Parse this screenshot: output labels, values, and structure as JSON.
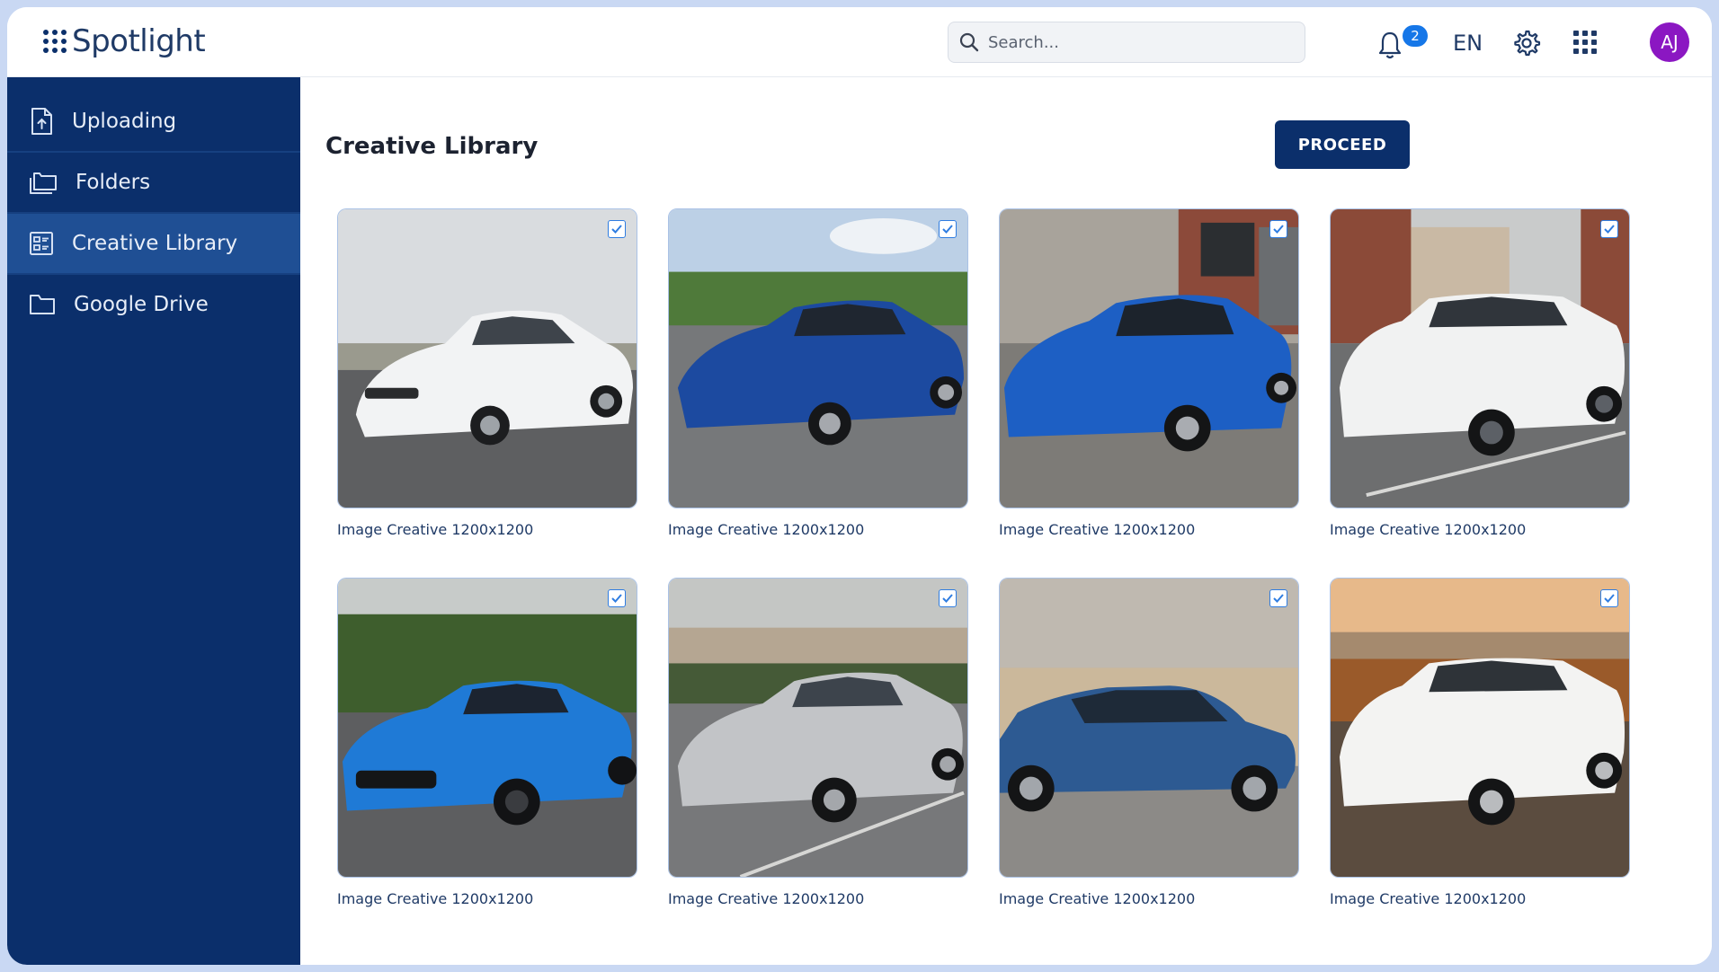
{
  "app": {
    "name": "Spotlight"
  },
  "header": {
    "search_placeholder": "Search...",
    "notifications_count": "2",
    "language": "EN",
    "user_initials": "AJ",
    "avatar_color": "#8b17c2"
  },
  "sidebar": {
    "items": [
      {
        "label": "Uploading",
        "icon": "upload-file-icon",
        "active": false
      },
      {
        "label": "Folders",
        "icon": "folders-icon",
        "active": false
      },
      {
        "label": "Creative Library",
        "icon": "library-icon",
        "active": true
      },
      {
        "label": "Google Drive",
        "icon": "folder-icon",
        "active": false
      }
    ]
  },
  "main": {
    "title": "Creative Library",
    "proceed_label": "PROCEED",
    "creatives": [
      {
        "caption": "Image Creative 1200x1200",
        "checked": true,
        "car": "white sedan"
      },
      {
        "caption": "Image Creative 1200x1200",
        "checked": true,
        "car": "blue sedan"
      },
      {
        "caption": "Image Creative 1200x1200",
        "checked": true,
        "car": "blue sedan"
      },
      {
        "caption": "Image Creative 1200x1200",
        "checked": true,
        "car": "white SUV"
      },
      {
        "caption": "Image Creative 1200x1200",
        "checked": true,
        "car": "blue coupe"
      },
      {
        "caption": "Image Creative 1200x1200",
        "checked": true,
        "car": "silver sedan"
      },
      {
        "caption": "Image Creative 1200x1200",
        "checked": true,
        "car": "blue hatchback"
      },
      {
        "caption": "Image Creative 1200x1200",
        "checked": true,
        "car": "white SUV"
      }
    ]
  },
  "colors": {
    "brand_navy": "#0b2f6b",
    "sidebar_active": "#1f4f94",
    "accent_blue": "#1677e8"
  }
}
